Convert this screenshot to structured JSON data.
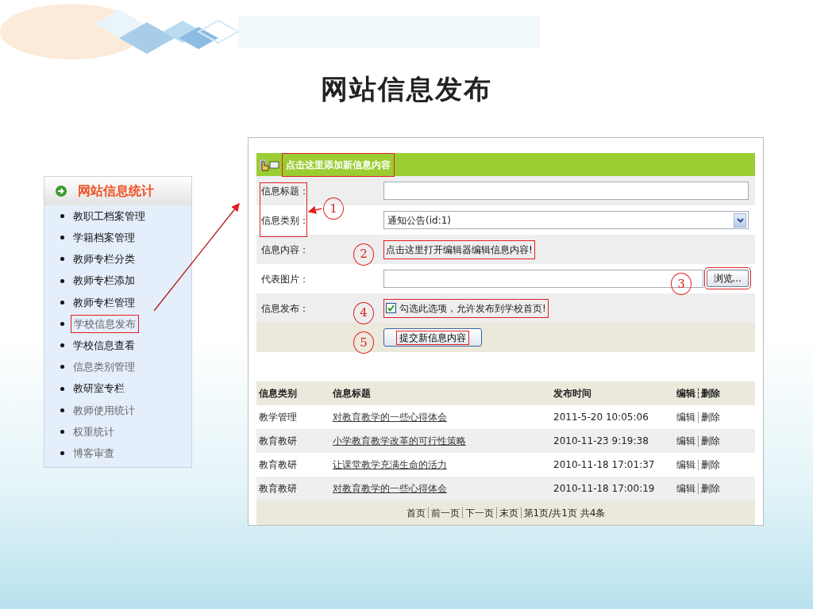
{
  "slide_title": "网站信息发布",
  "sidebar": {
    "title": "网站信息统计",
    "items": [
      {
        "label": "教职工档案管理",
        "dimmed": false,
        "boxed": false
      },
      {
        "label": "学籍档案管理",
        "dimmed": false,
        "boxed": false
      },
      {
        "label": "教师专栏分类",
        "dimmed": false,
        "boxed": false
      },
      {
        "label": "教师专栏添加",
        "dimmed": false,
        "boxed": false
      },
      {
        "label": "教师专栏管理",
        "dimmed": false,
        "boxed": false
      },
      {
        "label": "学校信息发布",
        "dimmed": true,
        "boxed": true
      },
      {
        "label": "学校信息查看",
        "dimmed": false,
        "boxed": false
      },
      {
        "label": "信息类别管理",
        "dimmed": true,
        "boxed": false
      },
      {
        "label": "教研室专栏",
        "dimmed": false,
        "boxed": false
      },
      {
        "label": "教师使用统计",
        "dimmed": true,
        "boxed": false
      },
      {
        "label": "权重统计",
        "dimmed": true,
        "boxed": false
      },
      {
        "label": "博客审查",
        "dimmed": true,
        "boxed": false
      }
    ]
  },
  "form": {
    "header": "点击这里添加新信息内容",
    "label_callout": "1",
    "fields": [
      {
        "kind": "text",
        "label": "信息标题："
      },
      {
        "kind": "select",
        "label": "信息类别：",
        "value": "通知公告(id:1)"
      },
      {
        "kind": "link",
        "label": "信息内容：",
        "text": "点击这里打开编辑器编辑信息内容!",
        "callout": "2"
      },
      {
        "kind": "file",
        "label": "代表图片：",
        "button": "浏览...",
        "callout": "3"
      },
      {
        "kind": "checkbox",
        "label": "信息发布：",
        "text": "勾选此选项，允许发布到学校首页!",
        "checked": true,
        "callout": "4"
      },
      {
        "kind": "submit",
        "button": "提交新信息内容",
        "callout": "5"
      }
    ]
  },
  "table": {
    "columns": [
      "信息类别",
      "信息标题",
      "发布时间",
      "编辑┆删除"
    ],
    "rows": [
      {
        "category": "教学管理",
        "title": "对教育教学的一些心得体会",
        "time": "2011-5-20 10:05:06",
        "actions": [
          "编辑",
          "删除"
        ]
      },
      {
        "category": "教育教研",
        "title": "小学教育教学改革的可行性策略",
        "time": "2010-11-23 9:19:38",
        "actions": [
          "编辑",
          "删除"
        ]
      },
      {
        "category": "教育教研",
        "title": "让课堂教学充满生命的活力",
        "time": "2010-11-18 17:01:37",
        "actions": [
          "编辑",
          "删除"
        ]
      },
      {
        "category": "教育教研",
        "title": "对教育教学的一些心得体会",
        "time": "2010-11-18 17:00:19",
        "actions": [
          "编辑",
          "删除"
        ]
      }
    ]
  },
  "pagination": {
    "links": [
      "首页",
      "前一页",
      "下一页",
      "末页"
    ],
    "info": "第1页/共1页 共4条"
  }
}
